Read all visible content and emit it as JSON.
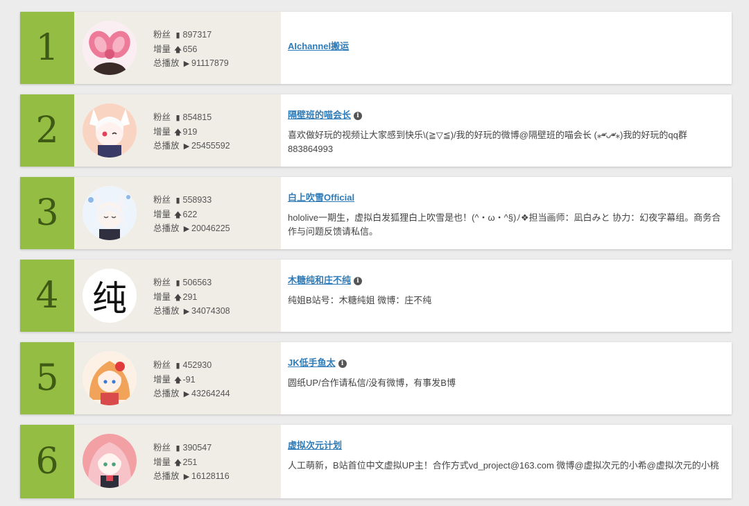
{
  "labels": {
    "fans": "粉丝",
    "growth": "增量",
    "plays": "总播放"
  },
  "uploaders": [
    {
      "rank": "1",
      "fans": "897317",
      "growth": "656",
      "plays": "91117879",
      "name": "AIchannel搬运",
      "has_info": false,
      "desc": ""
    },
    {
      "rank": "2",
      "fans": "854815",
      "growth": "919",
      "plays": "25455592",
      "name": "隔壁班的喵会长",
      "has_info": true,
      "desc": "喜欢做好玩的视频让大家感到快乐\\(≧▽≦)/我的好玩的微博@隔壁班的喵会长 (⁎⁍̴̛ᴗ⁍̴̛⁎)我的好玩的qq群883864993"
    },
    {
      "rank": "3",
      "fans": "558933",
      "growth": "622",
      "plays": "20046225",
      "name": "白上吹雪Official",
      "has_info": false,
      "desc": "hololive一期生，虚拟白发狐狸白上吹雪是也！(^・ω・^§)ﾉ❖担当画师：凪白みと 协力：幻夜字幕组。商务合作与问题反馈请私信。"
    },
    {
      "rank": "4",
      "fans": "506563",
      "growth": "291",
      "plays": "34074308",
      "name": "木糖纯和庄不纯",
      "has_info": true,
      "desc": "纯姐B站号：木糖纯姐 微博：庄不纯",
      "avatar_text": "纯"
    },
    {
      "rank": "5",
      "fans": "452930",
      "growth": "-91",
      "plays": "43264244",
      "name": "JK低手鱼太",
      "has_info": true,
      "desc": "圆纸UP/合作请私信/没有微博，有事发B博"
    },
    {
      "rank": "6",
      "fans": "390547",
      "growth": "251",
      "plays": "16128116",
      "name": "虚拟次元计划",
      "has_info": false,
      "desc": "人工萌新，B站首位中文虚拟UP主！合作方式vd_project@163.com 微博@虚拟次元的小希@虚拟次元的小桃"
    }
  ],
  "icons": {
    "fans": "bar-chart-icon",
    "growth": "arrow-up-icon",
    "plays": "play-icon",
    "info": "info-icon"
  },
  "colors": {
    "rank_bg": "#93bd43",
    "rank_text": "#3f5a14",
    "link": "#2f7bb7",
    "stats_bg": "#f0ede6"
  }
}
